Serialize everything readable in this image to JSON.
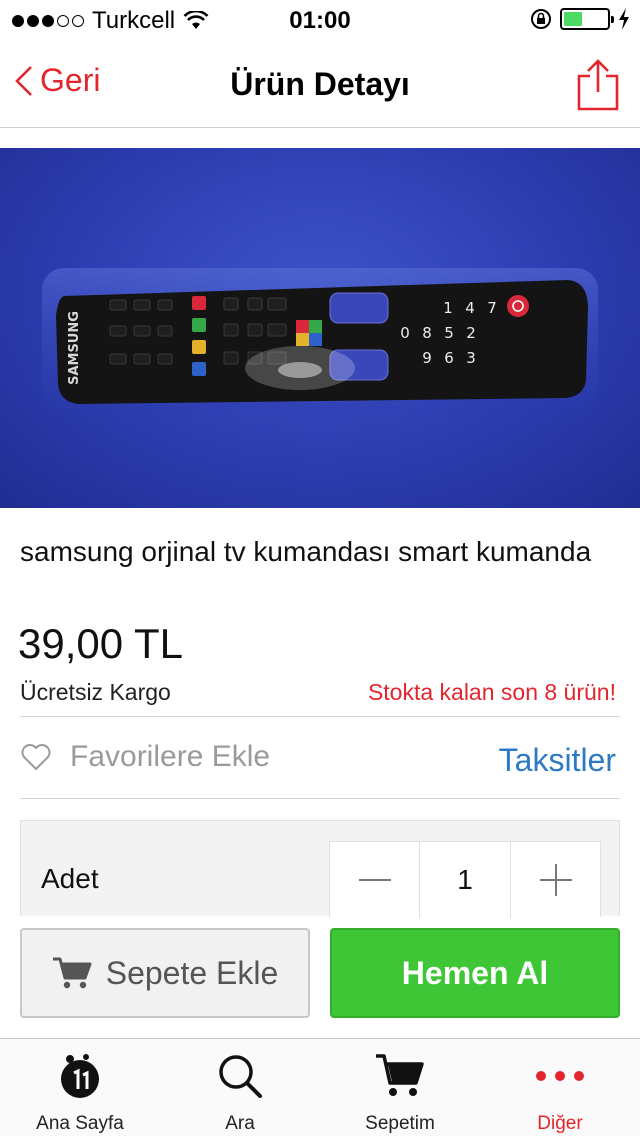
{
  "status_bar": {
    "carrier": "Turkcell",
    "time": "01:00",
    "signal_strength": "3 of 5",
    "battery_level": 0.42
  },
  "nav": {
    "back_label": "Geri",
    "title": "Ürün Detayı",
    "share_icon": "share-icon"
  },
  "product": {
    "title": "samsung  orjinal tv  kumandası smart kumanda",
    "price": "39,00 TL",
    "shipping": "Ücretsiz Kargo",
    "stock": "Stokta kalan son 8 ürün!",
    "image_subject": "samsung remote control",
    "image_text": "SAMSUNG"
  },
  "actions": {
    "favorite_label": "Favorilere Ekle",
    "installments_label": "Taksitler",
    "quantity_label": "Adet",
    "quantity_value": "1",
    "add_to_cart_label": "Sepete Ekle",
    "buy_now_label": "Hemen Al"
  },
  "tabs": [
    {
      "label": "Ana Sayfa",
      "icon": "home-logo-icon",
      "active": false
    },
    {
      "label": "Ara",
      "icon": "search-icon",
      "active": false
    },
    {
      "label": "Sepetim",
      "icon": "cart-icon",
      "active": false
    },
    {
      "label": "Diğer",
      "icon": "more-icon",
      "active": true
    }
  ],
  "colors": {
    "accent_red": "#e3262d",
    "link_blue": "#2d7ac4",
    "buy_green": "#3ec636",
    "image_background": "#2c3db0"
  }
}
